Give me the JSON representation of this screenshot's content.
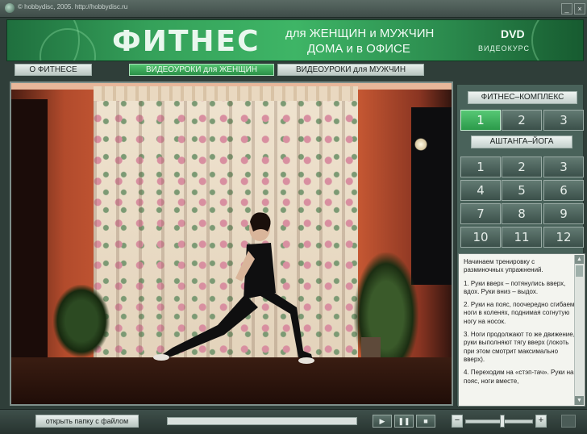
{
  "window": {
    "title": "© hobbydisc, 2005. http://hobbydisc.ru",
    "minimize_label": "_",
    "close_label": "×"
  },
  "banner": {
    "title": "ФИТНЕС",
    "subtitle_line1": "для ЖЕНЩИН и МУЖЧИН",
    "subtitle_line2": "ДОМА и в ОФИСЕ",
    "badge": "DVD",
    "badge_sub": "ВИДЕОКУРС"
  },
  "nav": {
    "about": "О ФИТНЕСЕ",
    "women": "ВИДЕОУРОКИ для ЖЕНЩИН",
    "men": "ВИДЕОУРОКИ для МУЖЧИН",
    "active": "women"
  },
  "panel": {
    "fitness_label": "ФИТНЕС–КОМПЛЕКС",
    "fitness_buttons": [
      "1",
      "2",
      "3"
    ],
    "fitness_selected": "1",
    "yoga_label": "АШТАНГА–ЙОГА",
    "yoga_buttons": [
      "1",
      "2",
      "3",
      "4",
      "5",
      "6",
      "7",
      "8",
      "9",
      "10",
      "11",
      "12"
    ]
  },
  "description": {
    "paragraphs": [
      "Начинаем тренировку с разминочных упражнений.",
      "1. Руки вверх – потянулись вверх, вдох. Руки вниз – выдох.",
      "2. Руки на пояс, поочередно сгибаем ноги в коленях, поднимая согнутую ногу на носок.",
      "3. Ноги продолжают то же движение, руки выполняют тягу вверх (локоть при этом смотрит максимально вверх).",
      "4. Переходим на «стэп-тач». Руки на пояс, ноги вместе,"
    ]
  },
  "controls": {
    "open_folder": "открыть папку с файлом",
    "play_icon": "play-icon",
    "pause_icon": "pause-icon",
    "stop_icon": "stop-icon",
    "vol_down": "−",
    "vol_up": "+",
    "progress_fraction": 0.0,
    "volume_fraction": 0.55
  },
  "colors": {
    "accent_green": "#2a9148",
    "panel_bg": "#49625a"
  }
}
